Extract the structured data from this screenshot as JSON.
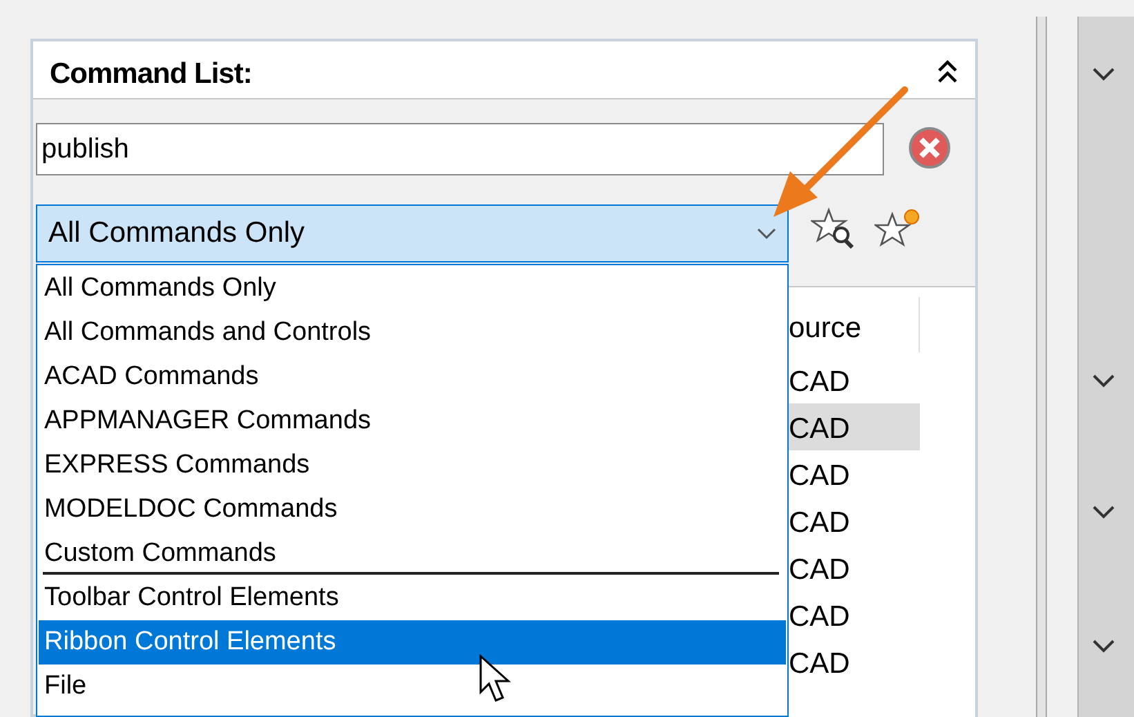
{
  "panel": {
    "title": "Command List:"
  },
  "search": {
    "value": "publish"
  },
  "filter": {
    "value": "All Commands Only",
    "expanded": true,
    "options": [
      {
        "label": "All Commands Only",
        "highlighted": false,
        "separator_after": false
      },
      {
        "label": "All Commands and Controls",
        "highlighted": false,
        "separator_after": false
      },
      {
        "label": "ACAD Commands",
        "highlighted": false,
        "separator_after": false
      },
      {
        "label": "APPMANAGER Commands",
        "highlighted": false,
        "separator_after": false
      },
      {
        "label": "EXPRESS Commands",
        "highlighted": false,
        "separator_after": false
      },
      {
        "label": "MODELDOC Commands",
        "highlighted": false,
        "separator_after": false
      },
      {
        "label": "Custom Commands",
        "highlighted": false,
        "separator_after": true
      },
      {
        "label": "Toolbar Control Elements",
        "highlighted": false,
        "separator_after": false
      },
      {
        "label": "Ribbon Control Elements",
        "highlighted": true,
        "separator_after": false
      },
      {
        "label": "File",
        "highlighted": false,
        "separator_after": false
      }
    ]
  },
  "table": {
    "columns": [
      "ource"
    ],
    "rows": [
      {
        "cell": "CAD",
        "selected": false
      },
      {
        "cell": "CAD",
        "selected": true
      },
      {
        "cell": "CAD",
        "selected": false
      },
      {
        "cell": "CAD",
        "selected": false
      },
      {
        "cell": "CAD",
        "selected": false
      },
      {
        "cell": "CAD",
        "selected": false
      },
      {
        "cell": "CAD",
        "selected": false
      }
    ]
  }
}
